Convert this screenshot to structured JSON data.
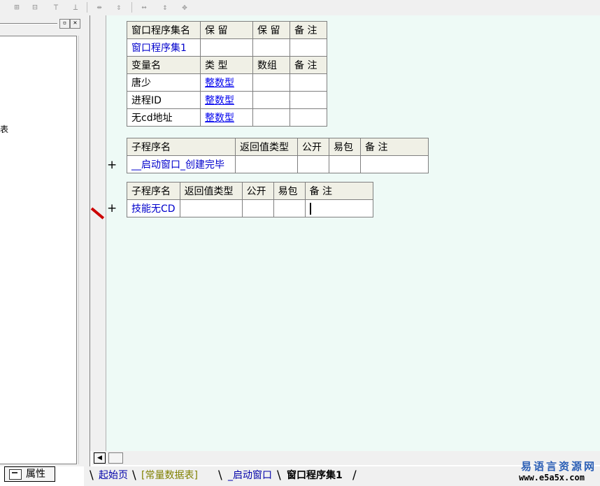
{
  "toolbar": {
    "icons": [
      "align-left-icon",
      "align-center-icon",
      "align-top-icon",
      "align-bottom-icon",
      "same-width-icon",
      "same-height-icon",
      "h-space-icon",
      "v-space-icon",
      "center-icon"
    ]
  },
  "left_panel": {
    "fragment": "表",
    "properties_tab": "属性"
  },
  "program_set": {
    "headers": [
      "窗口程序集名",
      "保 留",
      "保 留",
      "备 注"
    ],
    "row": [
      "窗口程序集1",
      "",
      "",
      ""
    ]
  },
  "variables": {
    "headers": [
      "变量名",
      "类 型",
      "数组",
      "备 注"
    ],
    "rows": [
      [
        "唐少",
        "整数型",
        "",
        ""
      ],
      [
        "进程ID",
        "整数型",
        "",
        ""
      ],
      [
        "无cd地址",
        "整数型",
        "",
        ""
      ]
    ]
  },
  "subprogram1": {
    "headers": [
      "子程序名",
      "返回值类型",
      "公开",
      "易包",
      "备 注"
    ],
    "row": [
      "__启动窗口_创建完毕",
      "",
      "",
      "",
      ""
    ]
  },
  "subprogram2": {
    "headers": [
      "子程序名",
      "返回值类型",
      "公开",
      "易包",
      "备 注"
    ],
    "row": [
      "技能无CD",
      "",
      "",
      "",
      ""
    ]
  },
  "gutter": {
    "plus": "+"
  },
  "tabs": {
    "items": [
      "起始页",
      "[常量数据表]",
      "_启动窗口",
      "窗口程序集1"
    ],
    "active": "窗口程序集1"
  },
  "colors": {
    "editor_bg": "#eefaf6",
    "header_bg": "#f0f0e6",
    "name_blue": "#0000cc",
    "type_link": "#0000ee",
    "constant_tab": "#808000"
  },
  "watermark": {
    "site": "易语言资源网",
    "url": "www.e5a5x.com"
  }
}
